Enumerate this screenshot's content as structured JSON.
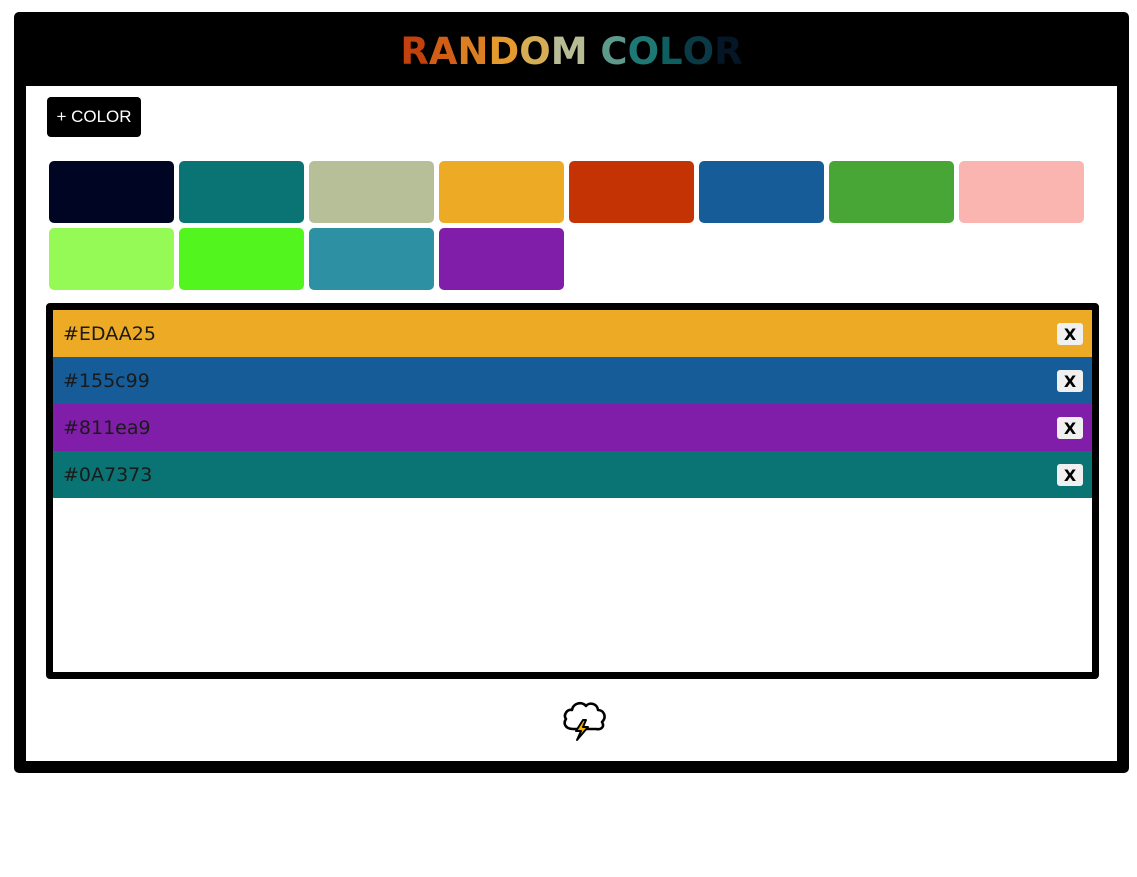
{
  "title": {
    "letters": [
      {
        "ch": "R",
        "color": "#C2410C"
      },
      {
        "ch": "A",
        "color": "#D15E16"
      },
      {
        "ch": "N",
        "color": "#DC7F22"
      },
      {
        "ch": "D",
        "color": "#E59A2F"
      },
      {
        "ch": "O",
        "color": "#D6AD55"
      },
      {
        "ch": "M",
        "color": "#B8BC95"
      },
      {
        "ch": " ",
        "color": "#000000"
      },
      {
        "ch": "C",
        "color": "#5E9A8C"
      },
      {
        "ch": "O",
        "color": "#1E7873"
      },
      {
        "ch": "L",
        "color": "#0F5E60"
      },
      {
        "ch": "O",
        "color": "#0A3A45"
      },
      {
        "ch": "R",
        "color": "#051626"
      }
    ]
  },
  "toolbar": {
    "add_label": "+ COLOR"
  },
  "palette": [
    "#000524",
    "#0A7373",
    "#B7BF99",
    "#EDAA25",
    "#C43304",
    "#155C99",
    "#47A635",
    "#FAB5B0",
    "#96FA56",
    "#52F51E",
    "#2D90A3",
    "#811EA9"
  ],
  "selected": [
    {
      "hex": "#EDAA25",
      "color": "#EDAA25",
      "remove_label": "X"
    },
    {
      "hex": "#155c99",
      "color": "#155C99",
      "remove_label": "X"
    },
    {
      "hex": "#811ea9",
      "color": "#811EA9",
      "remove_label": "X"
    },
    {
      "hex": "#0A7373",
      "color": "#0A7373",
      "remove_label": "X"
    }
  ],
  "generate": {
    "icon": "storm-cloud-icon"
  }
}
